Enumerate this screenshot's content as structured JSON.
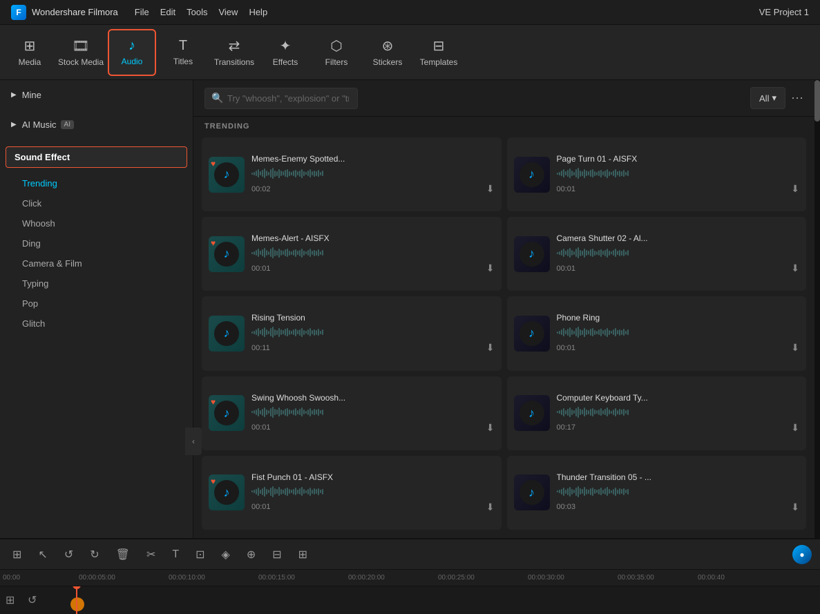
{
  "app": {
    "logo": "F",
    "name": "Wondershare Filmora",
    "menu": [
      "File",
      "Edit",
      "Tools",
      "View",
      "Help"
    ],
    "project": "VE Project 1"
  },
  "toolbar": {
    "items": [
      {
        "id": "media",
        "label": "Media",
        "icon": "⊞"
      },
      {
        "id": "stock-media",
        "label": "Stock Media",
        "icon": "📷"
      },
      {
        "id": "audio",
        "label": "Audio",
        "icon": "♪",
        "active": true
      },
      {
        "id": "titles",
        "label": "Titles",
        "icon": "T"
      },
      {
        "id": "transitions",
        "label": "Transitions",
        "icon": "↔"
      },
      {
        "id": "effects",
        "label": "Effects",
        "icon": "✦"
      },
      {
        "id": "filters",
        "label": "Filters",
        "icon": "⬡"
      },
      {
        "id": "stickers",
        "label": "Stickers",
        "icon": "⊛"
      },
      {
        "id": "templates",
        "label": "Templates",
        "icon": "⊟"
      }
    ]
  },
  "sidebar": {
    "mine_label": "Mine",
    "ai_music_label": "AI Music",
    "sound_effect_label": "Sound Effect",
    "sub_items": [
      {
        "id": "trending",
        "label": "Trending",
        "active": true
      },
      {
        "id": "click",
        "label": "Click"
      },
      {
        "id": "whoosh",
        "label": "Whoosh"
      },
      {
        "id": "ding",
        "label": "Ding"
      },
      {
        "id": "camera-film",
        "label": "Camera & Film"
      },
      {
        "id": "typing",
        "label": "Typing"
      },
      {
        "id": "pop",
        "label": "Pop"
      },
      {
        "id": "glitch",
        "label": "Glitch"
      }
    ]
  },
  "search": {
    "placeholder": "Try \"whoosh\", \"explosion\" or \"transition\"",
    "filter_label": "All"
  },
  "trending_label": "TRENDING",
  "audio_items": [
    {
      "id": 1,
      "title": "Memes-Enemy Spotted...",
      "duration": "00:02",
      "fav": true,
      "col": 0
    },
    {
      "id": 2,
      "title": "Page Turn 01 - AISFX",
      "duration": "00:01",
      "fav": false,
      "col": 1
    },
    {
      "id": 3,
      "title": "Memes-Alert - AISFX",
      "duration": "00:01",
      "fav": true,
      "col": 0
    },
    {
      "id": 4,
      "title": "Camera Shutter 02 - Al...",
      "duration": "00:01",
      "fav": false,
      "col": 1
    },
    {
      "id": 5,
      "title": "Rising Tension",
      "duration": "00:11",
      "fav": false,
      "col": 0
    },
    {
      "id": 6,
      "title": "Phone Ring",
      "duration": "00:01",
      "fav": false,
      "col": 1
    },
    {
      "id": 7,
      "title": "Swing Whoosh Swoosh...",
      "duration": "00:01",
      "fav": true,
      "col": 0
    },
    {
      "id": 8,
      "title": "Computer Keyboard Ty...",
      "duration": "00:17",
      "fav": false,
      "col": 1
    },
    {
      "id": 9,
      "title": "Fist Punch 01 - AISFX",
      "duration": "00:01",
      "fav": true,
      "col": 0
    },
    {
      "id": 10,
      "title": "Thunder Transition 05 - ...",
      "duration": "00:03",
      "fav": false,
      "col": 1
    }
  ],
  "timeline": {
    "markers": [
      "00:00",
      "00:00:05:00",
      "00:00:10:00",
      "00:00:15:00",
      "00:00:20:00",
      "00:00:25:00",
      "00:00:30:00",
      "00:00:35:00",
      "00:00:40"
    ]
  }
}
